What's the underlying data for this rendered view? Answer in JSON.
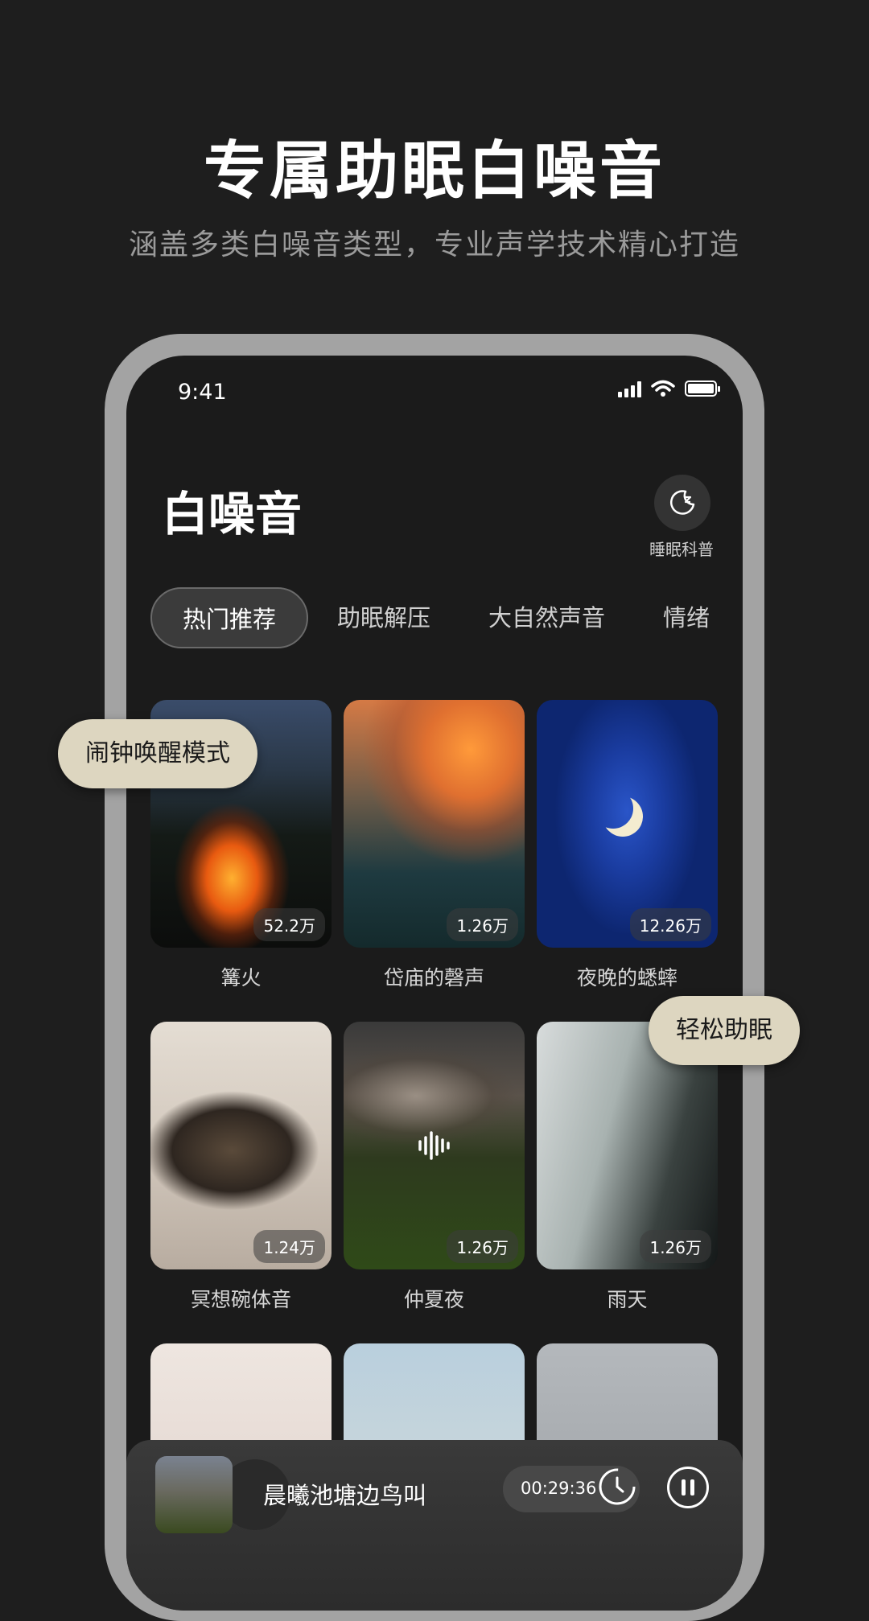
{
  "promo": {
    "title": "专属助眠白噪音",
    "subtitle": "涵盖多类白噪音类型，专业声学技术精心打造"
  },
  "status_bar": {
    "time": "9:41"
  },
  "header": {
    "title": "白噪音",
    "sleep_science_label": "睡眠科普",
    "sleep_science_icon": "moon-zz-icon"
  },
  "tabs": [
    {
      "label": "热门推荐",
      "active": true
    },
    {
      "label": "助眠解压"
    },
    {
      "label": "大自然声音"
    },
    {
      "label": "情绪"
    }
  ],
  "sounds": [
    {
      "title": "篝火",
      "plays": "52.2万"
    },
    {
      "title": "岱庙的磬声",
      "plays": "1.26万"
    },
    {
      "title": "夜晚的蟋蟀",
      "plays": "12.26万"
    },
    {
      "title": "冥想碗体音",
      "plays": "1.24万"
    },
    {
      "title": "仲夏夜",
      "plays": "1.26万",
      "playing": true
    },
    {
      "title": "雨天",
      "plays": "1.26万"
    },
    {
      "title": ""
    },
    {
      "title": ""
    },
    {
      "title": ""
    }
  ],
  "mini_player": {
    "title": "晨曦池塘边鸟叫",
    "timer": "00:29:36",
    "timer_icon": "clock-icon",
    "control_icon": "pause-icon"
  },
  "bubbles": {
    "alarm": "闹钟唤醒模式",
    "relax": "轻松助眠"
  },
  "colors": {
    "page_background": "#1e1e1e",
    "phone_frame": "#a3a3a3",
    "bubble_background": "#ddd6c0"
  }
}
